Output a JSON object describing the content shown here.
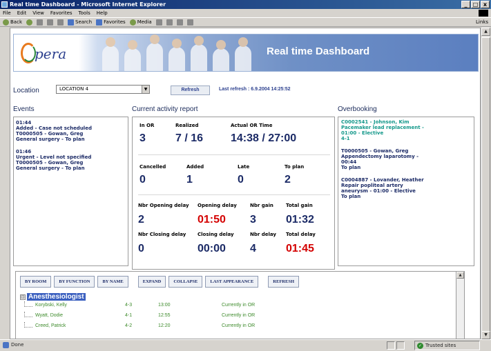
{
  "window": {
    "title": "Real time Dashboard - Microsoft Internet Explorer",
    "controls": [
      "_",
      "□",
      "x"
    ]
  },
  "menu": [
    "File",
    "Edit",
    "View",
    "Favorites",
    "Tools",
    "Help"
  ],
  "toolbar": {
    "back": "Back",
    "search": "Search",
    "favorites": "Favorites",
    "media": "Media",
    "links": "Links"
  },
  "banner": {
    "logo_text": "pera",
    "title": "Real time Dashboard"
  },
  "location": {
    "label": "Location",
    "value": "LOCATION 4",
    "refresh_label": "Refresh",
    "last_refresh": "Last refresh : 6.9.2004 14:25:52"
  },
  "sections": {
    "events": "Events",
    "activity": "Current activity report",
    "overbooking": "Overbooking"
  },
  "events": [
    {
      "time": "01:44",
      "lines": [
        "Added - Case not scheduled",
        "T0000505 - Gowan, Greg",
        "General surgery - To plan"
      ]
    },
    {
      "time": "01:46",
      "lines": [
        "Urgent - Level not specified",
        "T0000505 - Gowan, Greg",
        "General surgery - To plan"
      ]
    }
  ],
  "activity": {
    "in_or_label": "In OR",
    "in_or": "3",
    "realized_label": "Realized",
    "realized": "7 / 16",
    "actual_or_time_label": "Actual OR Time",
    "actual_or_time": "14:38 / 27:00",
    "cancelled_label": "Cancelled",
    "cancelled": "0",
    "added_label": "Added",
    "added": "1",
    "late_label": "Late",
    "late": "0",
    "to_plan_label": "To plan",
    "to_plan": "2",
    "nbr_opening_delay_label": "Nbr Opening delay",
    "nbr_opening_delay": "2",
    "opening_delay_label": "Opening delay",
    "opening_delay": "01:50",
    "nbr_gain_label": "Nbr gain",
    "nbr_gain": "3",
    "total_gain_label": "Total gain",
    "total_gain": "01:32",
    "nbr_closing_delay_label": "Nbr Closing delay",
    "nbr_closing_delay": "0",
    "closing_delay_label": "Closing delay",
    "closing_delay": "00:00",
    "nbr_delay_label": "Nbr delay",
    "nbr_delay": "4",
    "total_delay_label": "Total delay",
    "total_delay": "01:45",
    "red_color": "#d40000"
  },
  "overbooking": [
    {
      "lines": [
        "C0002541 - Johnson, Kim",
        "Pacemaker lead replacement -",
        "01:00 - Elective",
        "4-1"
      ],
      "color": "#13988a"
    },
    {
      "lines": [
        "T0000505 - Gowan, Greg",
        "Appendectomy laparotomy -",
        "00:44",
        "To plan"
      ],
      "color": "#1b2a66"
    },
    {
      "lines": [
        "C0004887 - Lovander, Heather",
        "Repair popliteal artery",
        "aneurysm - 01:00 - Elective",
        "To plan"
      ],
      "color": "#1b2a66"
    }
  ],
  "view_buttons": [
    "BY ROOM",
    "BY FUNCTION",
    "BY NAME",
    "EXPAND",
    "COLLAPSE",
    "LAST APPEARANCE",
    "REFRESH"
  ],
  "tree": {
    "toggle": "⊟",
    "group": "Anesthesiologist",
    "rows": [
      {
        "name": "Korybski, Kelly",
        "room": "4-3",
        "time": "13:00",
        "status": "Currently in OR"
      },
      {
        "name": "Wyatt, Dodie",
        "room": "4-1",
        "time": "12:55",
        "status": "Currently in OR"
      },
      {
        "name": "Creed, Patrick",
        "room": "4-2",
        "time": "12:20",
        "status": "Currently in OR"
      }
    ]
  },
  "status": {
    "done": "Done",
    "zone": "Trusted sites"
  }
}
